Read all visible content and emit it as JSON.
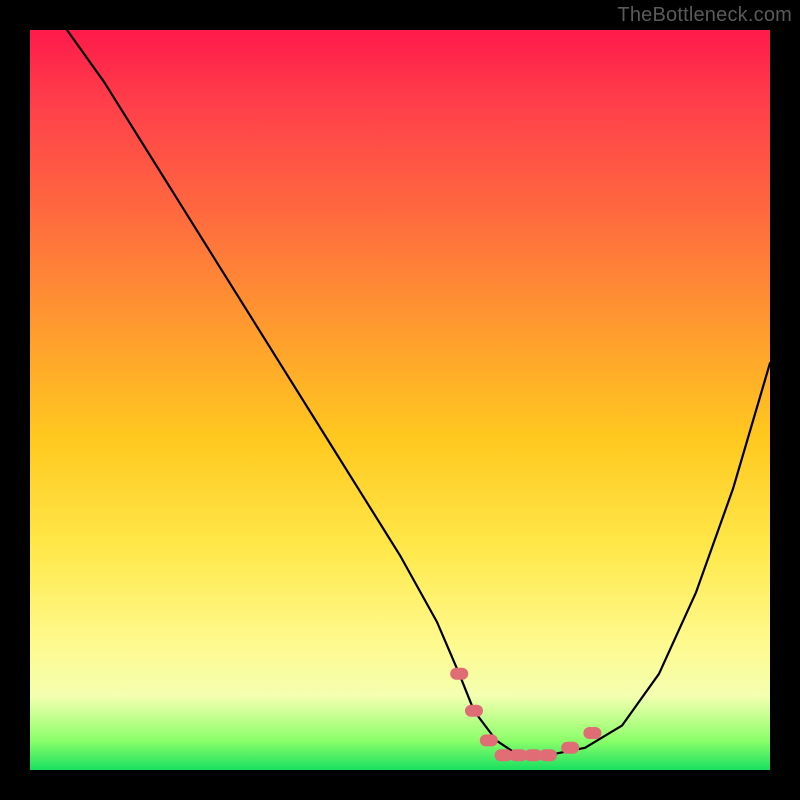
{
  "watermark": "TheBottleneck.com",
  "colors": {
    "background": "#000000",
    "gradient_top": "#ff1a4b",
    "gradient_mid1": "#ff9a2f",
    "gradient_mid2": "#ffe84a",
    "gradient_bottom": "#18e060",
    "curve_stroke": "#000000",
    "marker_fill": "#e06c75",
    "watermark_text": "#5a5a5a"
  },
  "chart_data": {
    "type": "line",
    "title": "",
    "xlabel": "",
    "ylabel": "",
    "xlim": [
      0,
      100
    ],
    "ylim": [
      0,
      100
    ],
    "grid": false,
    "legend": false,
    "series": [
      {
        "name": "bottleneck-curve",
        "x": [
          5,
          10,
          15,
          20,
          25,
          30,
          35,
          40,
          45,
          50,
          55,
          58,
          60,
          63,
          66,
          70,
          75,
          80,
          85,
          90,
          95,
          100
        ],
        "values": [
          100,
          93,
          85,
          77,
          69,
          61,
          53,
          45,
          37,
          29,
          20,
          13,
          8,
          4,
          2,
          2,
          3,
          6,
          13,
          24,
          38,
          55
        ]
      }
    ],
    "markers": [
      {
        "name": "flat-zone-left-edge",
        "x": 58,
        "y": 13
      },
      {
        "name": "flat-zone-start",
        "x": 60,
        "y": 8
      },
      {
        "name": "flat-zone-body-1",
        "x": 62,
        "y": 4
      },
      {
        "name": "flat-zone-body-2",
        "x": 64,
        "y": 2
      },
      {
        "name": "flat-zone-body-3",
        "x": 66,
        "y": 2
      },
      {
        "name": "flat-zone-body-4",
        "x": 68,
        "y": 2
      },
      {
        "name": "flat-zone-end",
        "x": 70,
        "y": 2
      },
      {
        "name": "flat-zone-right-edge",
        "x": 73,
        "y": 3
      },
      {
        "name": "flat-zone-right-edge-2",
        "x": 76,
        "y": 5
      }
    ]
  }
}
